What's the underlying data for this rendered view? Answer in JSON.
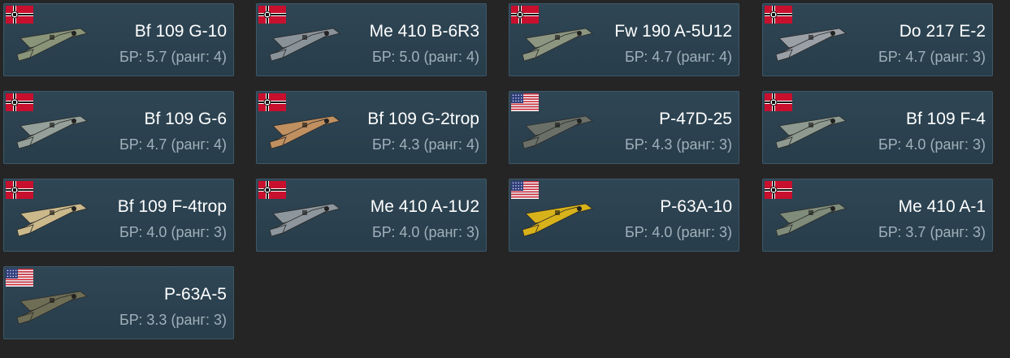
{
  "br_prefix": "БР:",
  "rank_word": "ранг:",
  "vehicles": [
    {
      "name": "Bf 109 G-10",
      "br": "5.7",
      "rank": "4",
      "nation": "germany",
      "flag_icon": "germany-flag-icon",
      "plane_icon": "bf-109-g-10-aircraft-icon",
      "color": "#8a9478"
    },
    {
      "name": "Me 410 B-6R3",
      "br": "5.0",
      "rank": "4",
      "nation": "germany",
      "flag_icon": "germany-flag-icon",
      "plane_icon": "me-410-b-6r3-aircraft-icon",
      "color": "#8a9299"
    },
    {
      "name": "Fw 190 A-5U12",
      "br": "4.7",
      "rank": "4",
      "nation": "germany",
      "flag_icon": "germany-flag-icon",
      "plane_icon": "fw-190-a-5u12-aircraft-icon",
      "color": "#8c9580"
    },
    {
      "name": "Do 217 E-2",
      "br": "4.7",
      "rank": "3",
      "nation": "germany",
      "flag_icon": "germany-flag-icon",
      "plane_icon": "do-217-e-2-aircraft-icon",
      "color": "#9aa0a6"
    },
    {
      "name": "Bf 109 G-6",
      "br": "4.7",
      "rank": "4",
      "nation": "germany",
      "flag_icon": "germany-flag-icon",
      "plane_icon": "bf-109-g-6-aircraft-icon",
      "color": "#95a09a"
    },
    {
      "name": "Bf 109 G-2trop",
      "br": "4.3",
      "rank": "4",
      "nation": "germany",
      "flag_icon": "germany-flag-icon",
      "plane_icon": "bf-109-g-2trop-aircraft-icon",
      "color": "#c09060"
    },
    {
      "name": "P-47D-25",
      "br": "4.3",
      "rank": "3",
      "nation": "usa",
      "flag_icon": "usa-flag-icon",
      "plane_icon": "p-47d-25-aircraft-icon",
      "color": "#6a7068"
    },
    {
      "name": "Bf 109 F-4",
      "br": "4.0",
      "rank": "3",
      "nation": "germany",
      "flag_icon": "germany-flag-icon",
      "plane_icon": "bf-109-f-4-aircraft-icon",
      "color": "#8e9a90"
    },
    {
      "name": "Bf 109 F-4trop",
      "br": "4.0",
      "rank": "3",
      "nation": "germany",
      "flag_icon": "germany-flag-icon",
      "plane_icon": "bf-109-f-4trop-aircraft-icon",
      "color": "#cbb98c"
    },
    {
      "name": "Me 410 A-1U2",
      "br": "4.0",
      "rank": "3",
      "nation": "germany",
      "flag_icon": "germany-flag-icon",
      "plane_icon": "me-410-a-1u2-aircraft-icon",
      "color": "#8d969c"
    },
    {
      "name": "P-63A-10",
      "br": "4.0",
      "rank": "3",
      "nation": "usa",
      "flag_icon": "usa-flag-icon",
      "plane_icon": "p-63a-10-aircraft-icon",
      "color": "#d8b21a"
    },
    {
      "name": "Me 410 A-1",
      "br": "3.7",
      "rank": "3",
      "nation": "germany",
      "flag_icon": "germany-flag-icon",
      "plane_icon": "me-410-a-1-aircraft-icon",
      "color": "#7f8c7a"
    },
    {
      "name": "P-63A-5",
      "br": "3.3",
      "rank": "3",
      "nation": "usa",
      "flag_icon": "usa-flag-icon",
      "plane_icon": "p-63a-5-aircraft-icon",
      "color": "#6e6d55"
    }
  ]
}
